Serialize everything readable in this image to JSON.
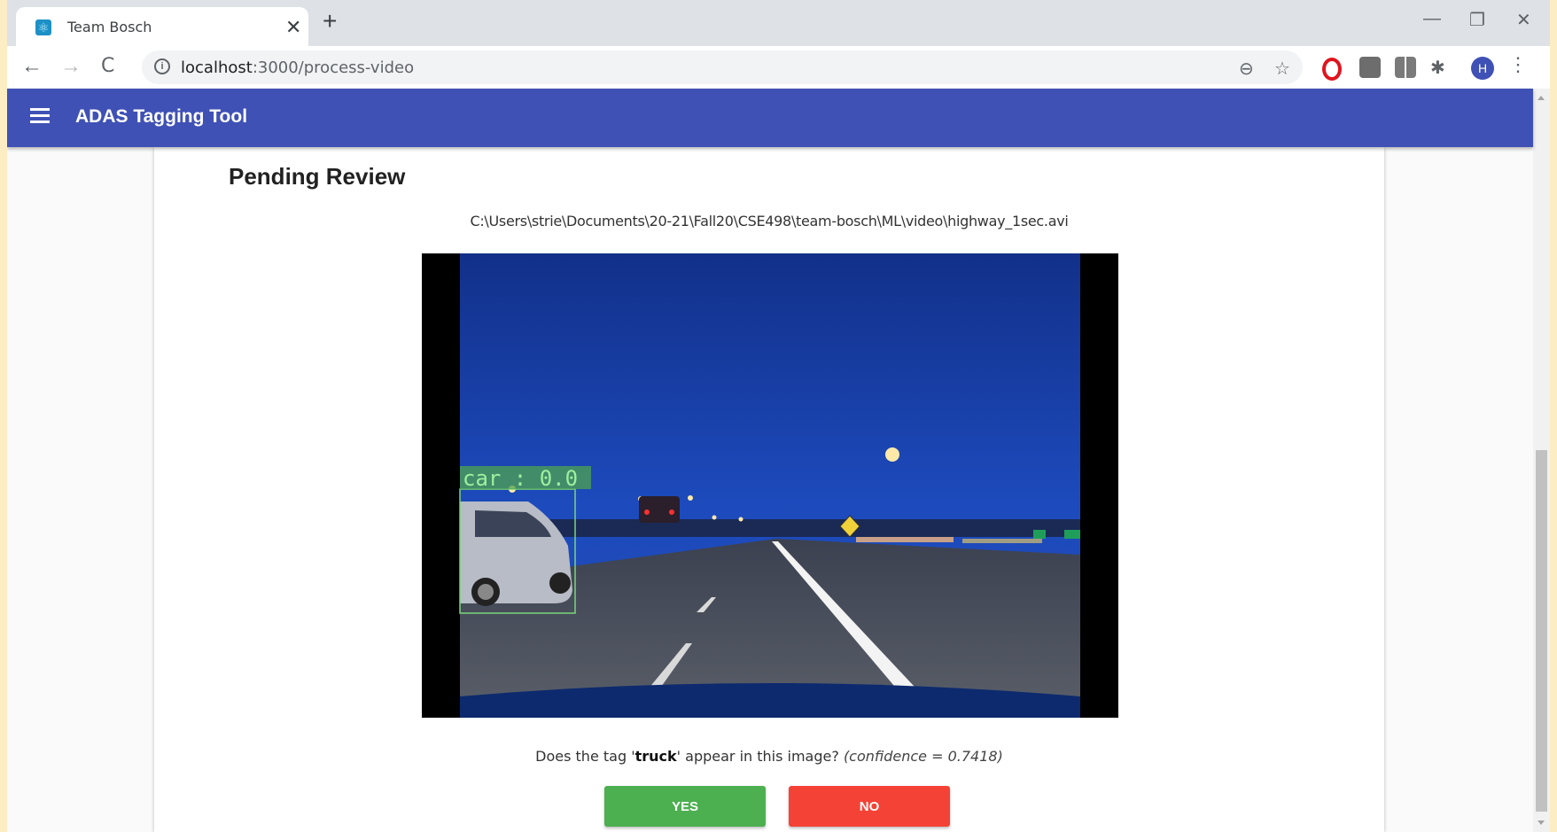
{
  "browser": {
    "tab_title": "Team Bosch",
    "tab_close": "✕",
    "new_tab": "+",
    "url_host": "localhost",
    "url_path": ":3000/process-video",
    "win_minimize": "—",
    "win_restore": "❐",
    "win_close": "✕",
    "avatar_letter": "H",
    "back": "←",
    "forward": "→",
    "reload": "C",
    "zoom": "⊖",
    "star": "☆",
    "menu": "⋮"
  },
  "app": {
    "title": "ADAS Tagging Tool"
  },
  "review": {
    "heading": "Pending Review",
    "file_path": "C:\\Users\\strie\\Documents\\20-21\\Fall20\\CSE498\\team-bosch\\ML\\video\\highway_1sec.avi",
    "question_prefix": "Does the tag '",
    "tag": "truck",
    "question_suffix": "' appear in this image? ",
    "confidence": "(confidence = 0.7418)",
    "yes_label": "YES",
    "no_label": "NO"
  },
  "video_frame": {
    "detection_label": "car : 0.0"
  },
  "colors": {
    "app_bar": "#3f51b5",
    "yes": "#4caf50",
    "no": "#f44336",
    "detection_box": "#7bd67b"
  }
}
